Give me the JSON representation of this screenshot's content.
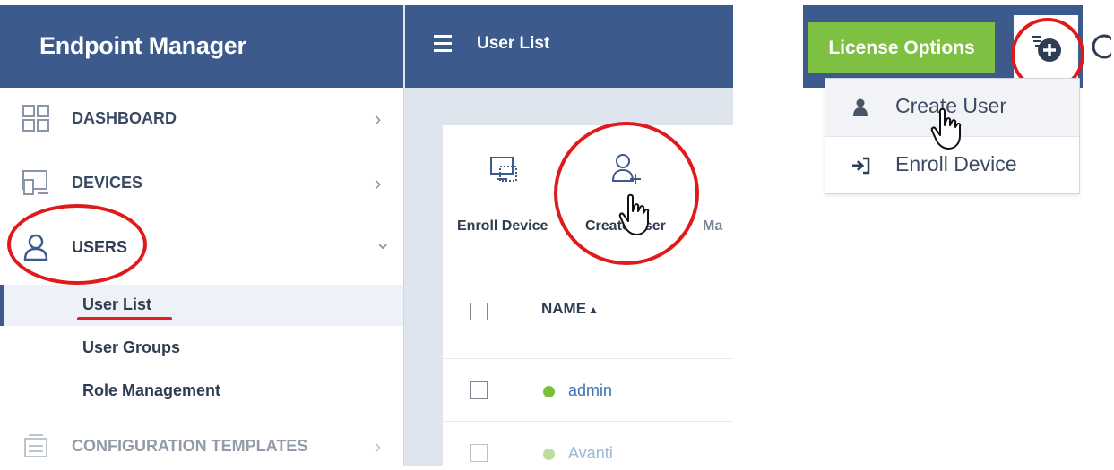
{
  "sidebar": {
    "app_title": "Endpoint Manager",
    "items": [
      {
        "label": "DASHBOARD",
        "icon": "dashboard-icon",
        "chevron": "›"
      },
      {
        "label": "DEVICES",
        "icon": "devices-icon",
        "chevron": "›"
      },
      {
        "label": "USERS",
        "icon": "user-icon",
        "chevron": "⌄"
      },
      {
        "label": "CONFIGURATION TEMPLATES",
        "icon": "configuration-templates-icon",
        "chevron": "›"
      }
    ],
    "subitems": [
      {
        "label": "User List"
      },
      {
        "label": "User Groups"
      },
      {
        "label": "Role Management"
      }
    ]
  },
  "topbar": {
    "title": "User List"
  },
  "toolbar": {
    "enroll_device": "Enroll Device",
    "create_user": "Create User",
    "truncated": "Ma"
  },
  "table": {
    "name_header": "NAME",
    "sort_indicator": "▲",
    "rows": [
      {
        "name": "admin",
        "status_color": "#7bbf3b"
      },
      {
        "name": "Avanti",
        "status_color": "#7bbf3b"
      }
    ]
  },
  "right_panel": {
    "license_options": "License Options",
    "add_button_icon": "add-circle-icon",
    "dropdown": [
      {
        "label": "Create User",
        "icon": "user-icon"
      },
      {
        "label": "Enroll Device",
        "icon": "sign-in-icon"
      }
    ]
  },
  "colors": {
    "header_blue": "#3c5a8c",
    "license_green": "#7ec142",
    "annotation_red": "#e01a1a",
    "link_blue": "#3d70b6"
  }
}
